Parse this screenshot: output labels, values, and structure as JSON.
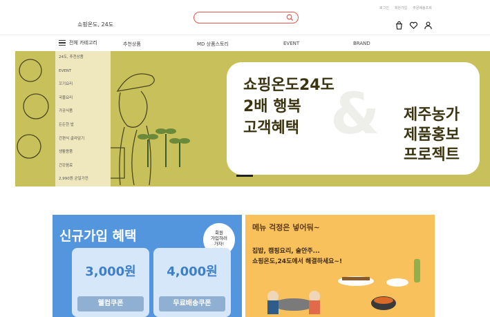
{
  "header": {
    "top_links": [
      "로그인",
      "회원가입",
      "주문배송조회"
    ],
    "logo": "쇼핑온도, 24도",
    "search": {
      "value": "",
      "placeholder": ""
    },
    "icons": [
      "shopping-bag-icon",
      "heart-icon",
      "user-icon"
    ],
    "accent_color": "#e8564b"
  },
  "nav": {
    "category_label": "전체 카테고리",
    "items": [
      "추천상품",
      "MD 상품스토리",
      "EVENT",
      "BRAND"
    ]
  },
  "category_menu": [
    "24도, 추천상품",
    "EVENT",
    "꼬기요리",
    "국물요리",
    "가공식품",
    "든든한 밥",
    "간편식 골라담기",
    "생활용품",
    "건강음료",
    "2,990원 균일가전"
  ],
  "banner": {
    "left_text": "쇼핑온도24도\n2배 행복\n고객혜택",
    "ampersand": "&",
    "right_text": "제주농가\n제품홍보\n프로젝트",
    "background_color": "#c8c05a"
  },
  "promo_signup": {
    "title": "신규가입 혜택",
    "badge": "회원\n가입하러\n가자!",
    "coupons": [
      {
        "amount": "3,000원",
        "label": "웰컴쿠폰"
      },
      {
        "amount": "4,000원",
        "label": "무료배송쿠폰"
      }
    ],
    "background_color": "#5396dd"
  },
  "promo_menu": {
    "title": "메뉴 걱정은 넣어둬~",
    "subtitle": "집밥, 캠핑요리, 술안주...\n쇼핑온도,24도에서 해결하세요~!",
    "background_color": "#f8c15c"
  }
}
